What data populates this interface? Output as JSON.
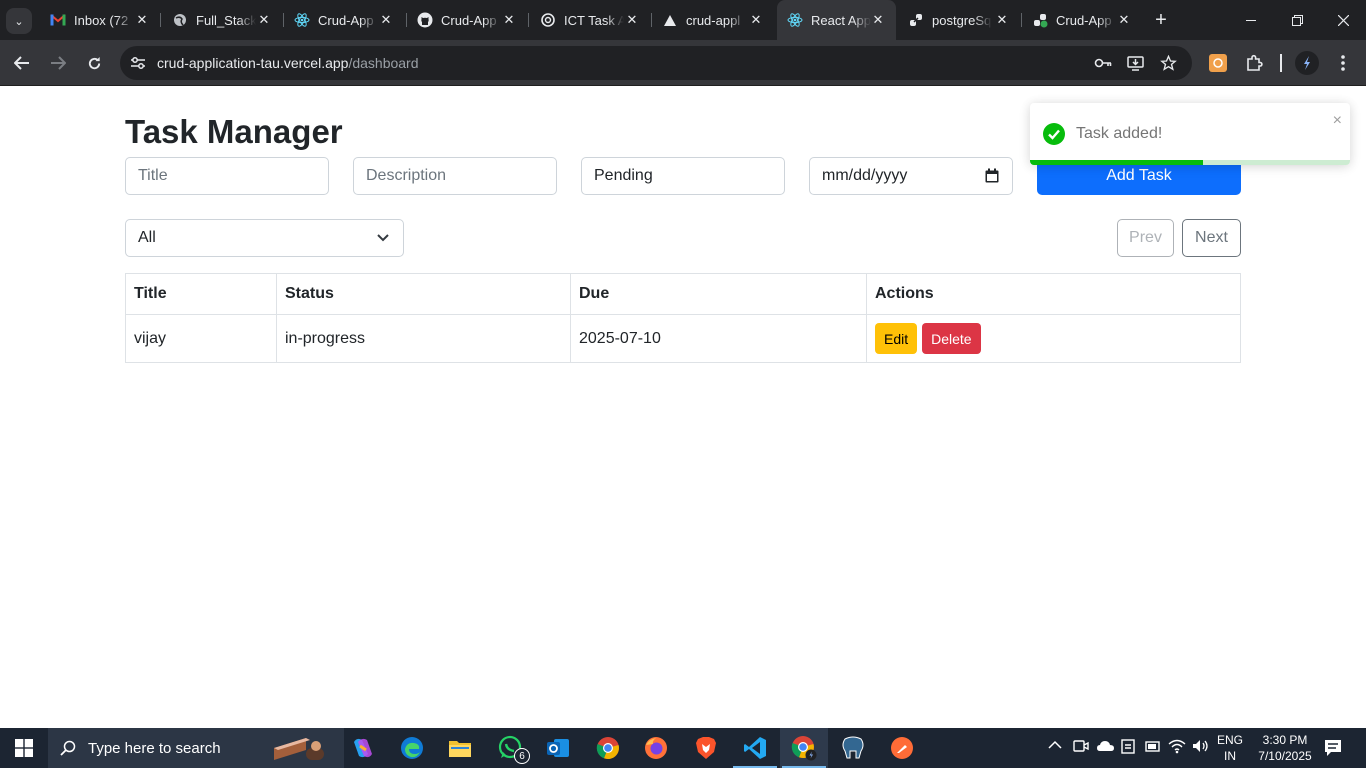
{
  "browser": {
    "tabs": [
      {
        "title": "Inbox (72",
        "favicon": "gmail-icon"
      },
      {
        "title": "Full_Stack",
        "favicon": "globe-icon"
      },
      {
        "title": "Crud-App",
        "favicon": "react-icon"
      },
      {
        "title": "Crud-App",
        "favicon": "github-icon"
      },
      {
        "title": "ICT Task A",
        "favicon": "openai-icon"
      },
      {
        "title": "crud-appl",
        "favicon": "vercel-icon"
      },
      {
        "title": "React App",
        "favicon": "react-icon",
        "active": true
      },
      {
        "title": "postgreSq",
        "favicon": "link-icon"
      },
      {
        "title": "Crud-App",
        "favicon": "link-check-icon"
      }
    ],
    "url_host": "crud-application-tau.vercel.app",
    "url_path": "/dashboard"
  },
  "app": {
    "title": "Task Manager",
    "form": {
      "title_placeholder": "Title",
      "description_placeholder": "Description",
      "status_value": "Pending",
      "date_placeholder": "mm/dd/yyyy",
      "add_label": "Add Task"
    },
    "filter_value": "All",
    "pagination": {
      "prev": "Prev",
      "next": "Next"
    },
    "table": {
      "headers": [
        "Title",
        "Status",
        "Due",
        "Actions"
      ],
      "rows": [
        {
          "title": "vijay",
          "status": "in-progress",
          "due": "2025-07-10",
          "edit": "Edit",
          "delete": "Delete"
        }
      ]
    },
    "toast": {
      "message": "Task added!",
      "close": "×",
      "progress": 0.54
    }
  },
  "taskbar": {
    "search_placeholder": "Type here to search",
    "whatsapp_badge": "6",
    "lang": "ENG",
    "region": "IN",
    "time": "3:30 PM",
    "date": "7/10/2025"
  },
  "colors": {
    "primary": "#0d6efd",
    "warning": "#ffc107",
    "danger": "#dc3545",
    "toast_success": "#07bc0c"
  }
}
